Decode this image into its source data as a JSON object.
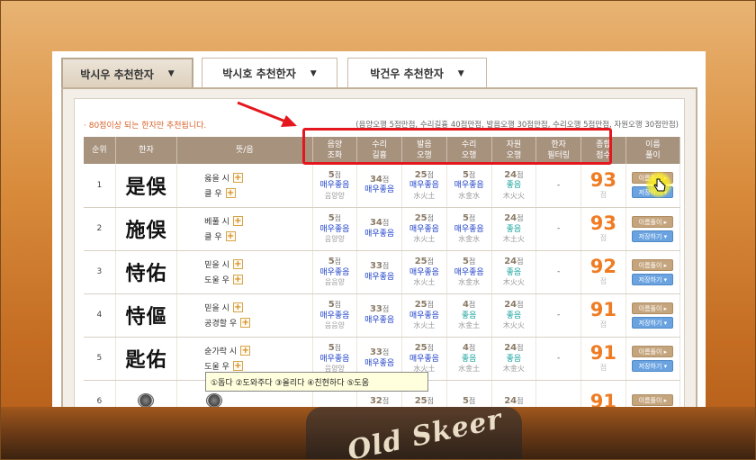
{
  "tabs": [
    {
      "label": "박시우 추천한자",
      "active": true
    },
    {
      "label": "박시호 추천한자",
      "active": false
    },
    {
      "label": "박건우 추천한자",
      "active": false
    }
  ],
  "note": "· 80점이상 되는 한자만 추천됩니다.",
  "score_legend": "(음양오행 5점만점, 수리길흉 40점만점, 발음오행 30점만점, 수리오행 5점만점, 자원오행 30점만점)",
  "headers": {
    "rank": "순위",
    "hanja": "한자",
    "meaning": "뜻/음",
    "yinyang": [
      "음양",
      "조화"
    ],
    "suri": [
      "수리",
      "길흉"
    ],
    "balum": [
      "발음",
      "오행"
    ],
    "suri_ohaeng": [
      "수리",
      "오행"
    ],
    "jawon": [
      "자원",
      "오행"
    ],
    "filter": [
      "한자",
      "필터링"
    ],
    "total": [
      "종합",
      "점수"
    ],
    "name_interp": [
      "이름",
      "풀이"
    ]
  },
  "buttons": {
    "interpret": "이름풀이 ▸",
    "save": "저장하기 ▾"
  },
  "pts_unit": "점",
  "rows": [
    {
      "rank": "1",
      "hanja": "是俁",
      "m1": "옳을 시",
      "m2": "클 우",
      "yy_pts": "5",
      "yy_grade": "매우좋음",
      "yy_sub": "음양양",
      "suri_pts": "34",
      "suri_grade": "매우좋음",
      "bal_pts": "25",
      "bal_grade": "매우좋음",
      "bal_sub": "水火土",
      "so_pts": "5",
      "so_grade": "매우좋음",
      "so_sub": "水金水",
      "jw_pts": "24",
      "jw_grade": "좋음",
      "jw_sub": "木火火",
      "filter": "-",
      "total": "93"
    },
    {
      "rank": "2",
      "hanja": "施俁",
      "m1": "베풀 시",
      "m2": "클 우",
      "yy_pts": "5",
      "yy_grade": "매우좋음",
      "yy_sub": "음양양",
      "suri_pts": "34",
      "suri_grade": "매우좋음",
      "bal_pts": "25",
      "bal_grade": "매우좋음",
      "bal_sub": "水火土",
      "so_pts": "5",
      "so_grade": "매우좋음",
      "so_sub": "水金水",
      "jw_pts": "24",
      "jw_grade": "좋음",
      "jw_sub": "木土火",
      "filter": "-",
      "total": "93"
    },
    {
      "rank": "3",
      "hanja": "恃佑",
      "m1": "믿을 시",
      "m2": "도울 우",
      "yy_pts": "5",
      "yy_grade": "매우좋음",
      "yy_sub": "음음양",
      "suri_pts": "33",
      "suri_grade": "매우좋음",
      "bal_pts": "25",
      "bal_grade": "매우좋음",
      "bal_sub": "水火土",
      "so_pts": "5",
      "so_grade": "매우좋음",
      "so_sub": "水金水",
      "jw_pts": "24",
      "jw_grade": "좋음",
      "jw_sub": "木火火",
      "filter": "-",
      "total": "92"
    },
    {
      "rank": "4",
      "hanja": "恃傴",
      "m1": "믿을 시",
      "m2": "공경할 우",
      "yy_pts": "5",
      "yy_grade": "매우좋음",
      "yy_sub": "음음양",
      "suri_pts": "33",
      "suri_grade": "매우좋음",
      "bal_pts": "25",
      "bal_grade": "매우좋음",
      "bal_sub": "水火土",
      "so_pts": "4",
      "so_grade": "좋음",
      "so_sub": "水金土",
      "jw_pts": "24",
      "jw_grade": "좋음",
      "jw_sub": "木火火",
      "filter": "-",
      "total": "91"
    },
    {
      "rank": "5",
      "hanja": "匙佑",
      "m1": "숟가락 시",
      "m2": "도울 우",
      "yy_pts": "5",
      "yy_grade": "매우좋음",
      "yy_sub": "음양양",
      "suri_pts": "33",
      "suri_grade": "매우좋음",
      "bal_pts": "25",
      "bal_grade": "매우좋음",
      "bal_sub": "水火土",
      "so_pts": "4",
      "so_grade": "좋음",
      "so_sub": "水金土",
      "jw_pts": "24",
      "jw_grade": "좋음",
      "jw_sub": "木金火",
      "filter": "-",
      "total": "91"
    },
    {
      "rank": "6",
      "hanja": "",
      "m1": "",
      "m2": "",
      "yy_pts": "",
      "yy_grade": "",
      "yy_sub": "",
      "suri_pts": "32",
      "suri_grade": "",
      "bal_pts": "25",
      "bal_grade": "",
      "bal_sub": "",
      "so_pts": "5",
      "so_grade": "",
      "so_sub": "",
      "jw_pts": "24",
      "jw_grade": "",
      "jw_sub": "",
      "filter": "",
      "total": "91"
    }
  ],
  "tooltip": "①돕다 ②도와주다 ③올리다 ④친현하다 ⑤도움",
  "background_text": "Old Skeer",
  "colors": {
    "total": "#ef7b22",
    "grade_blue": "#1c3fc8",
    "grade_teal": "#12a19b",
    "annotation_red": "#e4171e",
    "header_bg": "#a7927e"
  }
}
